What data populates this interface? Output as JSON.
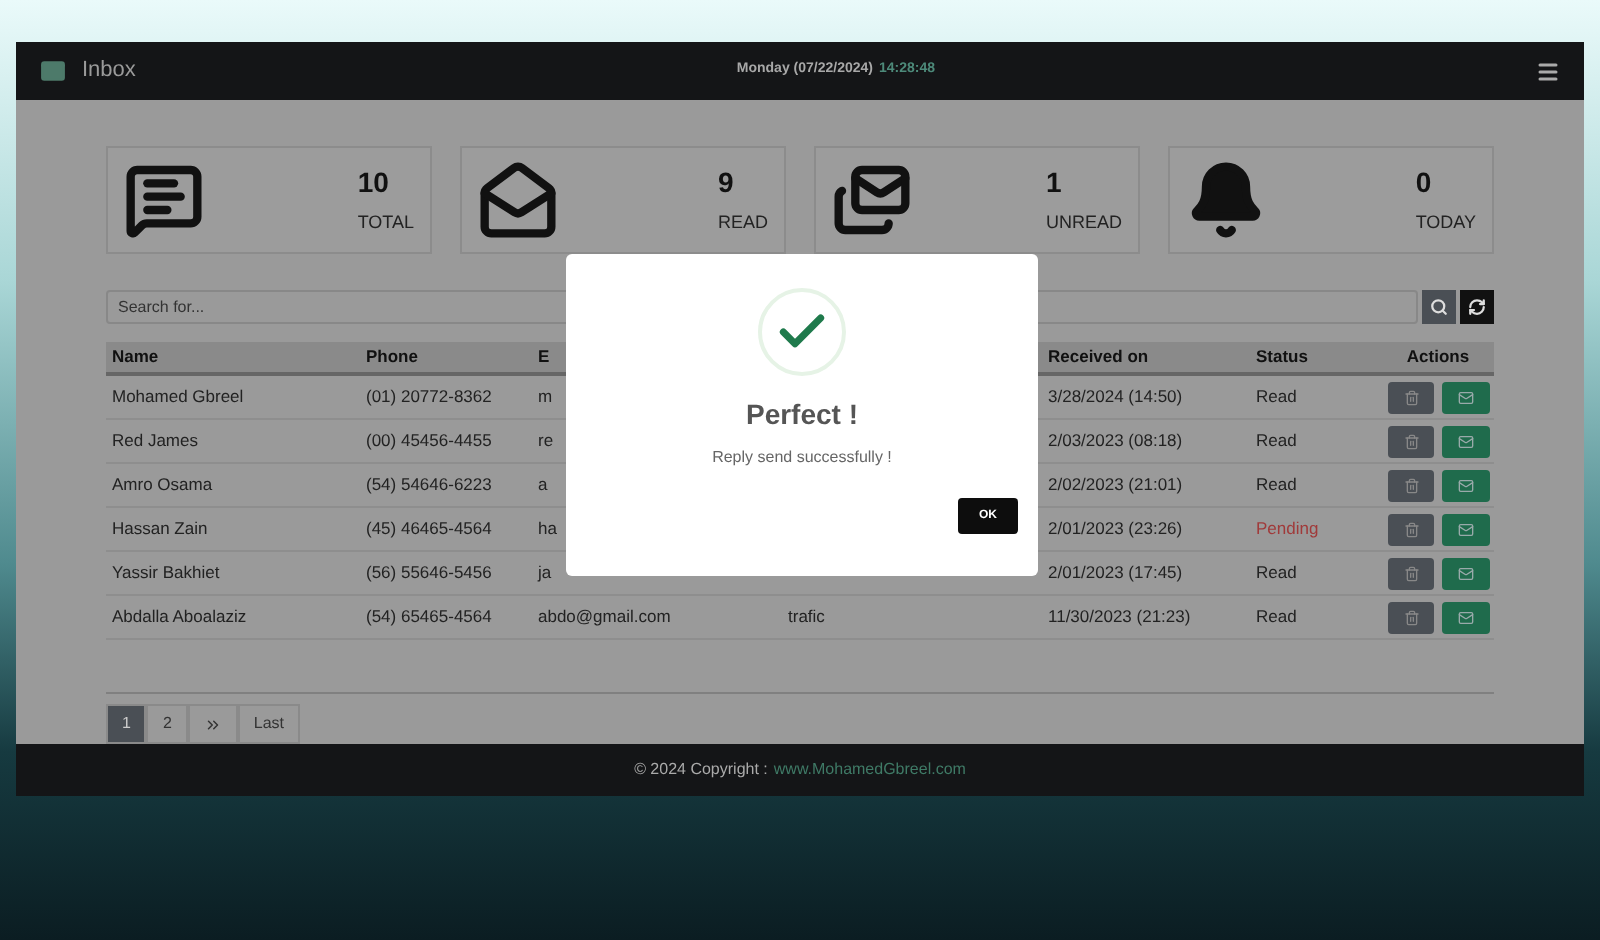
{
  "header": {
    "title": "Inbox",
    "date": "Monday (07/22/2024)",
    "time": "14:28:48"
  },
  "stats": [
    {
      "kind": "total",
      "value": "10",
      "label": "TOTAL"
    },
    {
      "kind": "read",
      "value": "9",
      "label": "READ"
    },
    {
      "kind": "unread",
      "value": "1",
      "label": "UNREAD"
    },
    {
      "kind": "today",
      "value": "0",
      "label": "TODAY"
    }
  ],
  "search": {
    "placeholder": "Search for..."
  },
  "table": {
    "columns": [
      "Name",
      "Phone",
      "E",
      "",
      "Received on",
      "Status",
      "Actions"
    ],
    "rows": [
      {
        "name": "Mohamed Gbreel",
        "phone": "(01) 20772-8362",
        "email": "m",
        "received": "3/28/2024 (14:50)",
        "status": "Read",
        "pending": false
      },
      {
        "name": "Red James",
        "phone": "(00) 45456-4455",
        "email": "re",
        "received": "2/03/2023 (08:18)",
        "status": "Read",
        "pending": false
      },
      {
        "name": "Amro Osama",
        "phone": "(54) 54646-6223",
        "email": "a",
        "received": "2/02/2023 (21:01)",
        "status": "Read",
        "pending": false
      },
      {
        "name": "Hassan Zain",
        "phone": "(45) 46465-4564",
        "email": "ha",
        "received": "2/01/2023 (23:26)",
        "status": "Pending",
        "pending": true
      },
      {
        "name": "Yassir Bakhiet",
        "phone": "(56) 55646-5456",
        "email": "ja",
        "received": "2/01/2023 (17:45)",
        "status": "Read",
        "pending": false
      },
      {
        "name": "Abdalla Aboalaziz",
        "phone": "(54) 65465-4564",
        "email": "abdo@gmail.com",
        "subject": "trafic",
        "received": "11/30/2023 (21:23)",
        "status": "Read",
        "pending": false
      }
    ]
  },
  "pagination": [
    {
      "kind": "page",
      "label": "1",
      "selected": true
    },
    {
      "kind": "page",
      "label": "2",
      "selected": false
    },
    {
      "kind": "next",
      "selected": false
    },
    {
      "kind": "page",
      "label": "Last",
      "selected": false
    }
  ],
  "footer": {
    "text": "© 2024 Copyright :",
    "link": "www.MohamedGbreel.com"
  },
  "dialog": {
    "title": "Perfect !",
    "message": "Reply send successfully !",
    "button": "OK"
  }
}
